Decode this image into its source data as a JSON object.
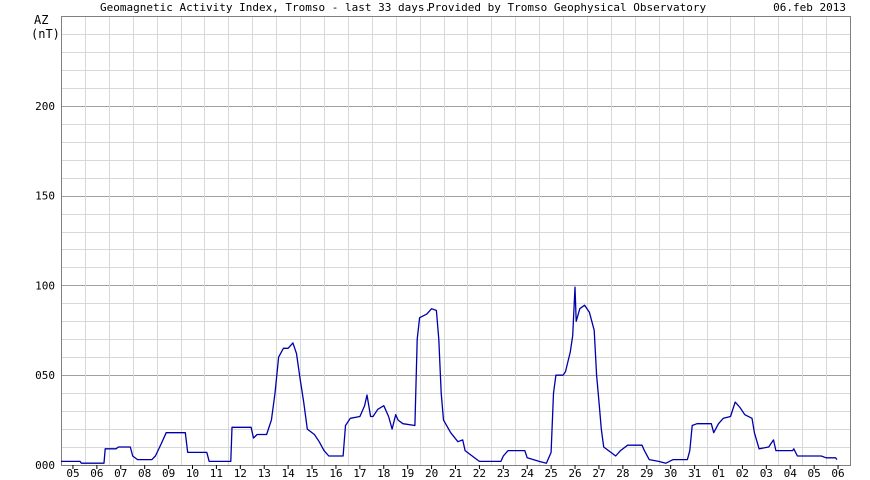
{
  "header": {
    "title": "Geomagnetic Activity Index, Tromso - last 33 days.",
    "provider": "Provided by Tromso Geophysical Observatory",
    "date": "06.feb 2013"
  },
  "colors": {
    "line": "#0000aa",
    "grid_major": "#a0a0a0",
    "grid_minor": "#d8d8d8",
    "background": "#ffffff"
  },
  "chart_data": {
    "type": "line",
    "title": "Geomagnetic Activity Index, Tromso - last 33 days.",
    "ylabel_top": "AZ",
    "ylabel_unit": "(nT)",
    "ylim": [
      0,
      250
    ],
    "xlim": [
      0,
      33
    ],
    "y_ticks": [
      {
        "value": 0,
        "label": "000"
      },
      {
        "value": 50,
        "label": "050"
      },
      {
        "value": 100,
        "label": "100"
      },
      {
        "value": 150,
        "label": "150"
      },
      {
        "value": 200,
        "label": "200"
      }
    ],
    "x_tick_labels": [
      "05",
      "06",
      "07",
      "08",
      "09",
      "10",
      "11",
      "12",
      "13",
      "14",
      "15",
      "16",
      "17",
      "18",
      "19",
      "20",
      "21",
      "22",
      "23",
      "24",
      "25",
      "26",
      "27",
      "28",
      "29",
      "30",
      "31",
      "01",
      "02",
      "03",
      "04",
      "05",
      "06"
    ],
    "grid": true,
    "series": [
      {
        "color": "#0000aa",
        "points": [
          [
            0.0,
            2
          ],
          [
            0.8,
            2
          ],
          [
            0.85,
            1
          ],
          [
            1.8,
            1
          ],
          [
            1.85,
            9
          ],
          [
            2.3,
            9
          ],
          [
            2.4,
            10
          ],
          [
            2.9,
            10
          ],
          [
            3.0,
            5
          ],
          [
            3.2,
            3
          ],
          [
            3.8,
            3
          ],
          [
            3.95,
            5
          ],
          [
            4.2,
            12
          ],
          [
            4.4,
            18
          ],
          [
            5.2,
            18
          ],
          [
            5.3,
            7
          ],
          [
            6.1,
            7
          ],
          [
            6.2,
            2
          ],
          [
            7.1,
            2
          ],
          [
            7.15,
            21
          ],
          [
            7.95,
            21
          ],
          [
            8.05,
            15
          ],
          [
            8.2,
            17
          ],
          [
            8.6,
            17
          ],
          [
            8.8,
            25
          ],
          [
            8.95,
            40
          ],
          [
            9.1,
            60
          ],
          [
            9.3,
            65
          ],
          [
            9.5,
            65
          ],
          [
            9.7,
            68
          ],
          [
            9.85,
            62
          ],
          [
            10.0,
            48
          ],
          [
            10.15,
            35
          ],
          [
            10.3,
            20
          ],
          [
            10.6,
            17
          ],
          [
            10.8,
            13
          ],
          [
            11.0,
            8
          ],
          [
            11.2,
            5
          ],
          [
            11.8,
            5
          ],
          [
            11.9,
            22
          ],
          [
            12.1,
            26
          ],
          [
            12.5,
            27
          ],
          [
            12.7,
            33
          ],
          [
            12.8,
            39
          ],
          [
            12.95,
            27
          ],
          [
            13.05,
            27
          ],
          [
            13.25,
            31
          ],
          [
            13.5,
            33
          ],
          [
            13.7,
            27
          ],
          [
            13.85,
            20
          ],
          [
            14.0,
            28
          ],
          [
            14.1,
            25
          ],
          [
            14.3,
            23
          ],
          [
            14.8,
            22
          ],
          [
            14.9,
            70
          ],
          [
            15.0,
            82
          ],
          [
            15.3,
            84
          ],
          [
            15.5,
            87
          ],
          [
            15.7,
            86
          ],
          [
            15.8,
            70
          ],
          [
            15.9,
            40
          ],
          [
            16.0,
            25
          ],
          [
            16.3,
            18
          ],
          [
            16.6,
            13
          ],
          [
            16.8,
            14
          ],
          [
            16.9,
            8
          ],
          [
            17.2,
            5
          ],
          [
            17.4,
            3
          ],
          [
            17.5,
            2
          ],
          [
            18.4,
            2
          ],
          [
            18.5,
            5
          ],
          [
            18.7,
            8
          ],
          [
            19.4,
            8
          ],
          [
            19.5,
            4
          ],
          [
            20.0,
            2
          ],
          [
            20.3,
            1
          ],
          [
            20.5,
            7
          ],
          [
            20.6,
            40
          ],
          [
            20.7,
            50
          ],
          [
            21.0,
            50
          ],
          [
            21.1,
            52
          ],
          [
            21.3,
            63
          ],
          [
            21.4,
            72
          ],
          [
            21.5,
            99
          ],
          [
            21.55,
            80
          ],
          [
            21.7,
            87
          ],
          [
            21.9,
            89
          ],
          [
            22.1,
            85
          ],
          [
            22.3,
            75
          ],
          [
            22.4,
            50
          ],
          [
            22.5,
            35
          ],
          [
            22.6,
            20
          ],
          [
            22.7,
            10
          ],
          [
            23.0,
            7
          ],
          [
            23.2,
            5
          ],
          [
            23.4,
            8
          ],
          [
            23.7,
            11
          ],
          [
            24.3,
            11
          ],
          [
            24.4,
            8
          ],
          [
            24.6,
            3
          ],
          [
            25.0,
            2
          ],
          [
            25.3,
            1
          ],
          [
            25.6,
            3
          ],
          [
            26.2,
            3
          ],
          [
            26.3,
            8
          ],
          [
            26.4,
            22
          ],
          [
            26.6,
            23
          ],
          [
            27.2,
            23
          ],
          [
            27.3,
            18
          ],
          [
            27.5,
            23
          ],
          [
            27.7,
            26
          ],
          [
            28.0,
            27
          ],
          [
            28.2,
            35
          ],
          [
            28.4,
            32
          ],
          [
            28.6,
            28
          ],
          [
            28.9,
            26
          ],
          [
            29.0,
            18
          ],
          [
            29.2,
            9
          ],
          [
            29.6,
            10
          ],
          [
            29.8,
            14
          ],
          [
            29.9,
            8
          ],
          [
            30.6,
            8
          ],
          [
            30.65,
            9
          ],
          [
            30.8,
            5
          ],
          [
            31.8,
            5
          ],
          [
            32.0,
            4
          ],
          [
            32.4,
            4
          ],
          [
            32.45,
            3
          ]
        ]
      }
    ]
  }
}
